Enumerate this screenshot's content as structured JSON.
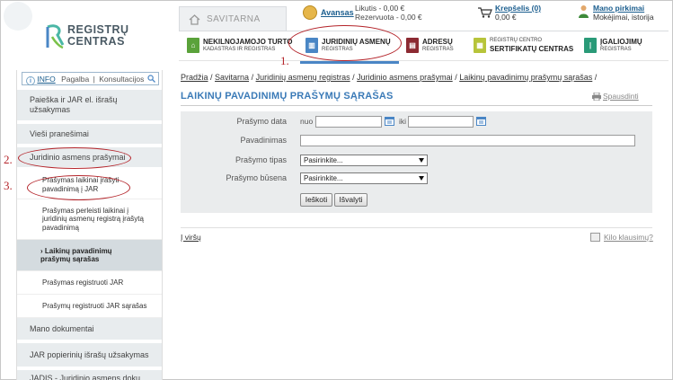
{
  "logo": {
    "line1": "REGISTRŲ",
    "line2": "CENTRAS"
  },
  "topbar": {
    "savitarna": "SAVITARNA",
    "avansas": "Avansas",
    "likutis": "Likutis - 0,00 €",
    "rezervuota": "Rezervuota - 0,00 €",
    "krepselis": "Krepšelis (0)",
    "krepselis_sum": "0,00 €",
    "mano_pirkimai": "Mano pirkimai",
    "mano_sub": "Mokėjimai, istorija"
  },
  "registries": [
    {
      "t1": "NEKILNOJAMOJO TURTO",
      "t2": "KADASTRAS IR REGISTRAS",
      "color": "#5aa23a",
      "glyph": "nt"
    },
    {
      "t1": "JURIDINIŲ ASMENŲ",
      "t2": "REGISTRAS",
      "color": "#4a86c5",
      "glyph": "ja"
    },
    {
      "t1": "ADRESŲ",
      "t2": "REGISTRAS",
      "color": "#8c2a32",
      "glyph": "a"
    },
    {
      "t1": "REGISTRŲ CENTRO",
      "t2": "SERTIFIKATŲ CENTRAS",
      "color": "#b7c43a",
      "glyph": "rc"
    },
    {
      "t1": "ĮGALIOJIMŲ",
      "t2": "REGISTRAS",
      "color": "#2a9a78",
      "glyph": "į"
    }
  ],
  "annotations": {
    "m1": "1.",
    "m2": "2.",
    "m3": "3."
  },
  "sidebar": {
    "info": "INFO",
    "pagalba": "Pagalba",
    "konsultacijos": "Konsultacijos",
    "items": [
      "Paieška ir JAR el. išrašų užsakymas",
      "Vieši pranešimai",
      "Juridinio asmens prašymai",
      "Mano dokumentai",
      "JAR popierinių išrašų užsakymas",
      "JADIS - Juridinio asmens dokų"
    ],
    "subitems": [
      "Prašymas laikinai įrašyti pavadinimą į JAR",
      "Prašymas perleisti laikinai į juridinių asmenų registrą įrašytą pavadinimą",
      "› Laikinų pavadinimų prašymų sąrašas",
      "Prašymas registruoti JAR",
      "Prašymų registruoti JAR sąrašas"
    ]
  },
  "breadcrumb": [
    "Pradžia",
    "Savitarna",
    "Juridinių asmenų registras",
    "Juridinio asmens prašymai",
    "Laikinų pavadinimų prašymų sąrašas"
  ],
  "title": "LAIKINŲ PAVADINIMŲ PRAŠYMŲ SĄRAŠAS",
  "print": "Spausdinti",
  "form": {
    "date_label": "Prašymo data",
    "nuo": "nuo",
    "iki": "iki",
    "date_from": "",
    "date_to": "",
    "name_label": "Pavadinimas",
    "name_value": "",
    "type_label": "Prašymo tipas",
    "type_value": "Pasirinkite...",
    "status_label": "Prašymo būsena",
    "status_value": "Pasirinkite...",
    "search_btn": "Ieškoti",
    "clear_btn": "Išvalyti"
  },
  "footer": {
    "top": "Į viršų",
    "help": "Kilo klausimų?"
  },
  "colors": {
    "accent": "#3a7ab7",
    "annotation": "#b4242a",
    "sidebar_bg": "#e8ecee"
  }
}
